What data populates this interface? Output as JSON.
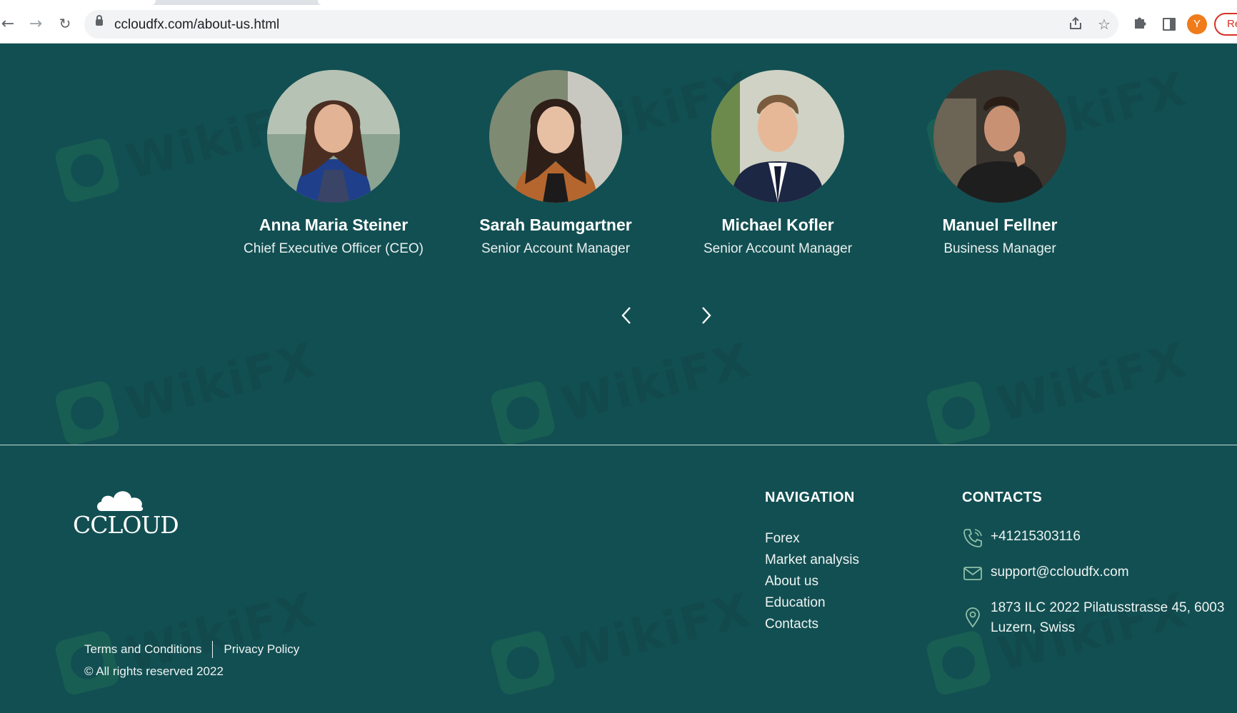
{
  "browser": {
    "url": "ccloudfx.com/about-us.html",
    "avatar_initial": "Y",
    "reload_label": "Re",
    "icons": {
      "back": "arrow-left-icon",
      "forward": "arrow-right-icon",
      "reload": "reload-icon",
      "lock": "lock-icon",
      "share": "share-icon",
      "bookmark": "star-icon",
      "extensions": "puzzle-icon",
      "side_panel": "side-panel-icon"
    }
  },
  "team": [
    {
      "name": "Anna Maria Steiner",
      "role": "Chief Executive Officer (CEO)"
    },
    {
      "name": "Sarah Baumgartner",
      "role": "Senior Account Manager"
    },
    {
      "name": "Michael Kofler",
      "role": "Senior Account Manager"
    },
    {
      "name": "Manuel Fellner",
      "role": "Business Manager"
    }
  ],
  "watermark": {
    "text": "WikiFX"
  },
  "footer": {
    "logo_text": "CCLOUD",
    "navigation": {
      "heading": "NAVIGATION",
      "items": [
        "Forex",
        "Market analysis",
        "About us",
        "Education",
        "Contacts"
      ]
    },
    "contacts": {
      "heading": "CONTACTS",
      "phone": "+41215303116",
      "email": "support@ccloudfx.com",
      "address_line1": "1873 ILC 2022 Pilatusstrasse 45, 6003",
      "address_line2": "Luzern, Swiss"
    },
    "terms": "Terms and Conditions",
    "privacy": "Privacy Policy",
    "copyright": "© All rights reserved 2022"
  },
  "colors": {
    "background": "#124f52",
    "text": "#ffffff",
    "avatar": "#f07b1b",
    "accent_red": "#d93025"
  }
}
